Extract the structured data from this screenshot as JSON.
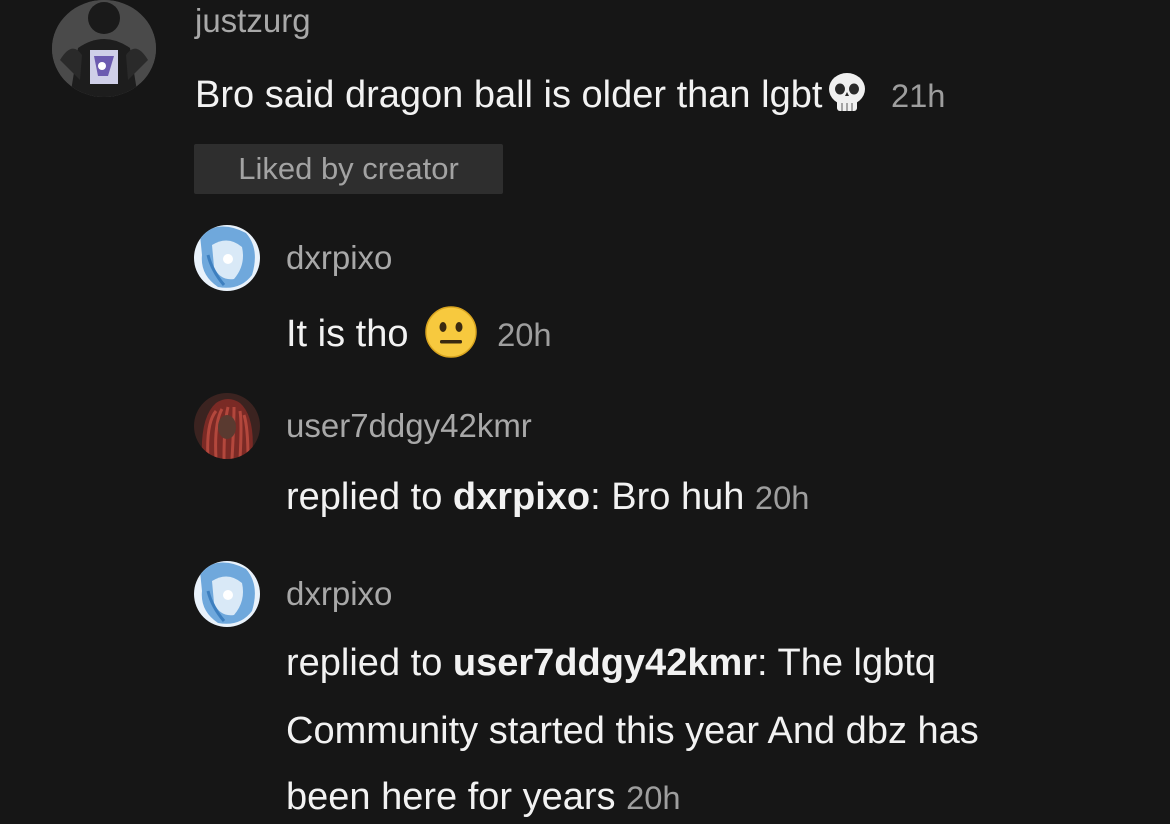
{
  "comments": [
    {
      "username": "justzurg",
      "text": "Bro said dragon ball is older than lgbt",
      "emoji": "skull-emoji",
      "time": "21h",
      "badge": "Liked by creator"
    },
    {
      "username": "dxrpixo",
      "text": "It is tho",
      "emoji": "neutral-face-emoji",
      "time": "20h"
    },
    {
      "username": "user7ddgy42kmr",
      "prefix": "replied to",
      "mention": "dxrpixo",
      "colon": ":",
      "text": " Bro huh",
      "time": "20h"
    },
    {
      "username": "dxrpixo",
      "prefix": "replied to",
      "mention": "user7ddgy42kmr",
      "colon": ":",
      "text_line1": " The lgbtq",
      "text_line2": "Community started this year And dbz has",
      "text_line3": "been here for years",
      "time": "20h"
    }
  ],
  "colors": {
    "background": "#161616",
    "text": "#f2f2f2",
    "muted": "#a8a8a8",
    "badge_bg": "#2e2e2e"
  }
}
